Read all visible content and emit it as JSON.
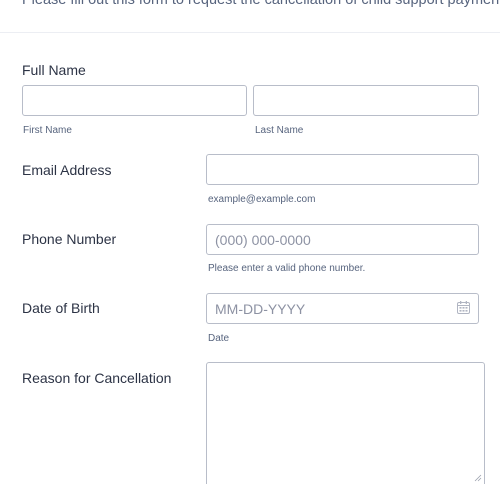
{
  "form": {
    "subtitle": "Please fill out this form to request the cancellation of child support payments.",
    "full_name": {
      "label": "Full Name",
      "first": {
        "value": "",
        "sublabel": "First Name"
      },
      "last": {
        "value": "",
        "sublabel": "Last Name"
      }
    },
    "email": {
      "label": "Email Address",
      "value": "",
      "sublabel": "example@example.com"
    },
    "phone": {
      "label": "Phone Number",
      "placeholder": "(000) 000-0000",
      "sublabel": "Please enter a valid phone number."
    },
    "dob": {
      "label": "Date of Birth",
      "placeholder": "MM-DD-YYYY",
      "sublabel": "Date",
      "icon": "calendar-icon"
    },
    "reason": {
      "label": "Reason for Cancellation",
      "value": "",
      "icon": "resize-handle-icon"
    }
  },
  "colors": {
    "text": "#2c3345",
    "muted": "#57647e",
    "border": "#b8bdc9",
    "placeholder": "#8d92a3"
  }
}
